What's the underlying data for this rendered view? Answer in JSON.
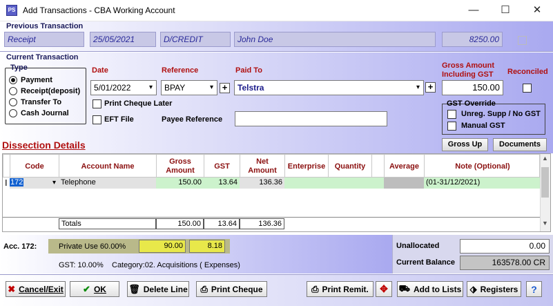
{
  "window": {
    "title": "Add Transactions - CBA Working Account",
    "app_icon": "PS",
    "minimize": "—",
    "maximize": "☐",
    "close": "✕"
  },
  "previous": {
    "title": "Previous Transaction",
    "type": "Receipt",
    "date": "25/05/2021",
    "ref": "D/CREDIT",
    "payee": "John Doe",
    "amount": "8250.00"
  },
  "current": {
    "title": "Current Transaction",
    "type_label": "Type",
    "types": [
      "Payment",
      "Receipt(deposit)",
      "Transfer To",
      "Cash Journal"
    ],
    "selected_type": "Payment",
    "date_label": "Date",
    "date_value": "5/01/2022",
    "reference_label": "Reference",
    "reference_value": "BPAY",
    "paidto_label": "Paid To",
    "paidto_value": "Telstra",
    "gross_label_1": "Gross Amount",
    "gross_label_2": "Including GST",
    "gross_value": "150.00",
    "reconciled_label": "Reconciled",
    "print_cheque_label": "Print Cheque Later",
    "eft_label": "EFT File",
    "payee_ref_label": "Payee Reference",
    "payee_ref_value": "",
    "gst_override_label": "GST Override",
    "unreg_label": "Unreg. Supp / No GST",
    "manual_gst_label": "Manual GST",
    "gross_up_label": "Gross Up",
    "documents_label": "Documents"
  },
  "dissection": {
    "title": "Dissection Details",
    "headers": {
      "code": "Code",
      "account": "Account Name",
      "gross1": "Gross",
      "gross2": "Amount",
      "gst": "GST",
      "net1": "Net",
      "net2": "Amount",
      "enterprise": "Enterprise",
      "quantity": "Quantity",
      "average": "Average",
      "note": "Note (Optional)"
    },
    "row": {
      "code": "172",
      "account": "Telephone",
      "gross": "150.00",
      "gst": "13.64",
      "net": "136.36",
      "note": "(01-31/12/2021)"
    },
    "totals": {
      "label": "Totals",
      "gross": "150.00",
      "gst": "13.64",
      "net": "136.36"
    }
  },
  "account_info": {
    "acc_label": "Acc. 172:",
    "private_use": "Private Use 60.00%",
    "private_amount": "90.00",
    "private_gst": "8.18",
    "gst_rate": "GST: 10.00%",
    "category": "Category:02. Acquisitions ( Expenses)",
    "unallocated_label": "Unallocated",
    "unallocated_value": "0.00",
    "balance_label": "Current Balance",
    "balance_value": "163578.00 CR"
  },
  "buttons": {
    "cancel": "Cancel/Exit",
    "ok": "OK",
    "delete": "Delete Line",
    "print_cheque": "Print Cheque",
    "print_remit": "Print Remit.",
    "add_lists": "Add to Lists",
    "registers": "Registers",
    "help": "?"
  },
  "colors": {
    "panel_accent": "#a9a9f0",
    "label_red": "#b01010",
    "row_green": "#ccf2cc",
    "private_yellow": "#e8e84a"
  }
}
